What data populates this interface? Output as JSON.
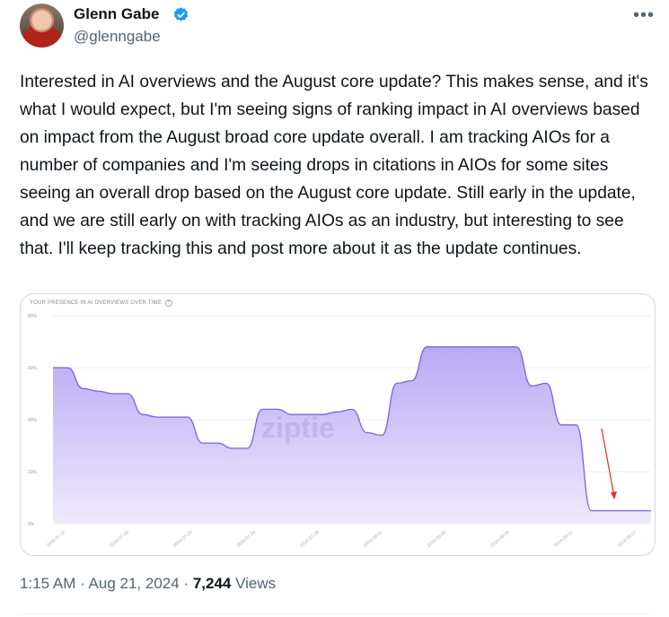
{
  "author": {
    "name": "Glenn Gabe",
    "handle": "@glenngabe",
    "verified": true,
    "avatar_icon": "avatar-photo"
  },
  "menu": {
    "more_label": "•••"
  },
  "tweet": {
    "text": "Interested in AI overviews and the August core update? This makes sense, and it's what I would expect, but I'm seeing signs of ranking impact in AI overviews based on impact from the August broad core update overall. I am tracking AIOs for a number of companies and I'm seeing drops in citations in AIOs for some sites seeing an overall drop based on the August core update. Still early in the update, and we are still early on with tracking AIOs as an industry, but interesting to see that. I'll keep tracking this and post more about it as the update continues."
  },
  "chart_data": {
    "type": "area",
    "title": "YOUR PRESENCE IN AI OVERVIEWS OVER TIME",
    "watermark": "ziptie",
    "yticks": [
      "0%",
      "20%",
      "40%",
      "60%",
      "80%"
    ],
    "ylim": [
      0,
      80
    ],
    "xticks": [
      "2024-07-12",
      "2024-07-16",
      "2024-07-20",
      "2024-07-24",
      "2024-07-28",
      "2024-08-01",
      "2024-08-05",
      "2024-08-09",
      "2024-08-13",
      "2024-08-17"
    ],
    "x": [
      0,
      1,
      2,
      3,
      4,
      5,
      6,
      7,
      8,
      9,
      10,
      11,
      12,
      13,
      14,
      15,
      16,
      17,
      18,
      19,
      20,
      21,
      22,
      23,
      24,
      25,
      26,
      27,
      28,
      29,
      30,
      31,
      32,
      33,
      34,
      35,
      36,
      37,
      38,
      39,
      40
    ],
    "values": [
      60,
      60,
      52,
      51,
      50,
      50,
      42,
      41,
      41,
      41,
      31,
      31,
      29,
      29,
      44,
      44,
      42,
      42,
      42,
      43,
      44,
      35,
      34,
      54,
      55,
      68,
      68,
      68,
      68,
      68,
      68,
      68,
      53,
      54,
      38,
      38,
      5,
      5,
      5,
      5,
      5
    ],
    "series_color": "#7b61e0",
    "fill_top": "#b9a9f5",
    "fill_bottom": "#efeafc",
    "arrow_color": "#e03030",
    "grid": true
  },
  "footer": {
    "time": "1:15 AM",
    "sep": " · ",
    "date": "Aug 21, 2024",
    "sep2": " · ",
    "views": "7,244",
    "views_label": " Views"
  }
}
